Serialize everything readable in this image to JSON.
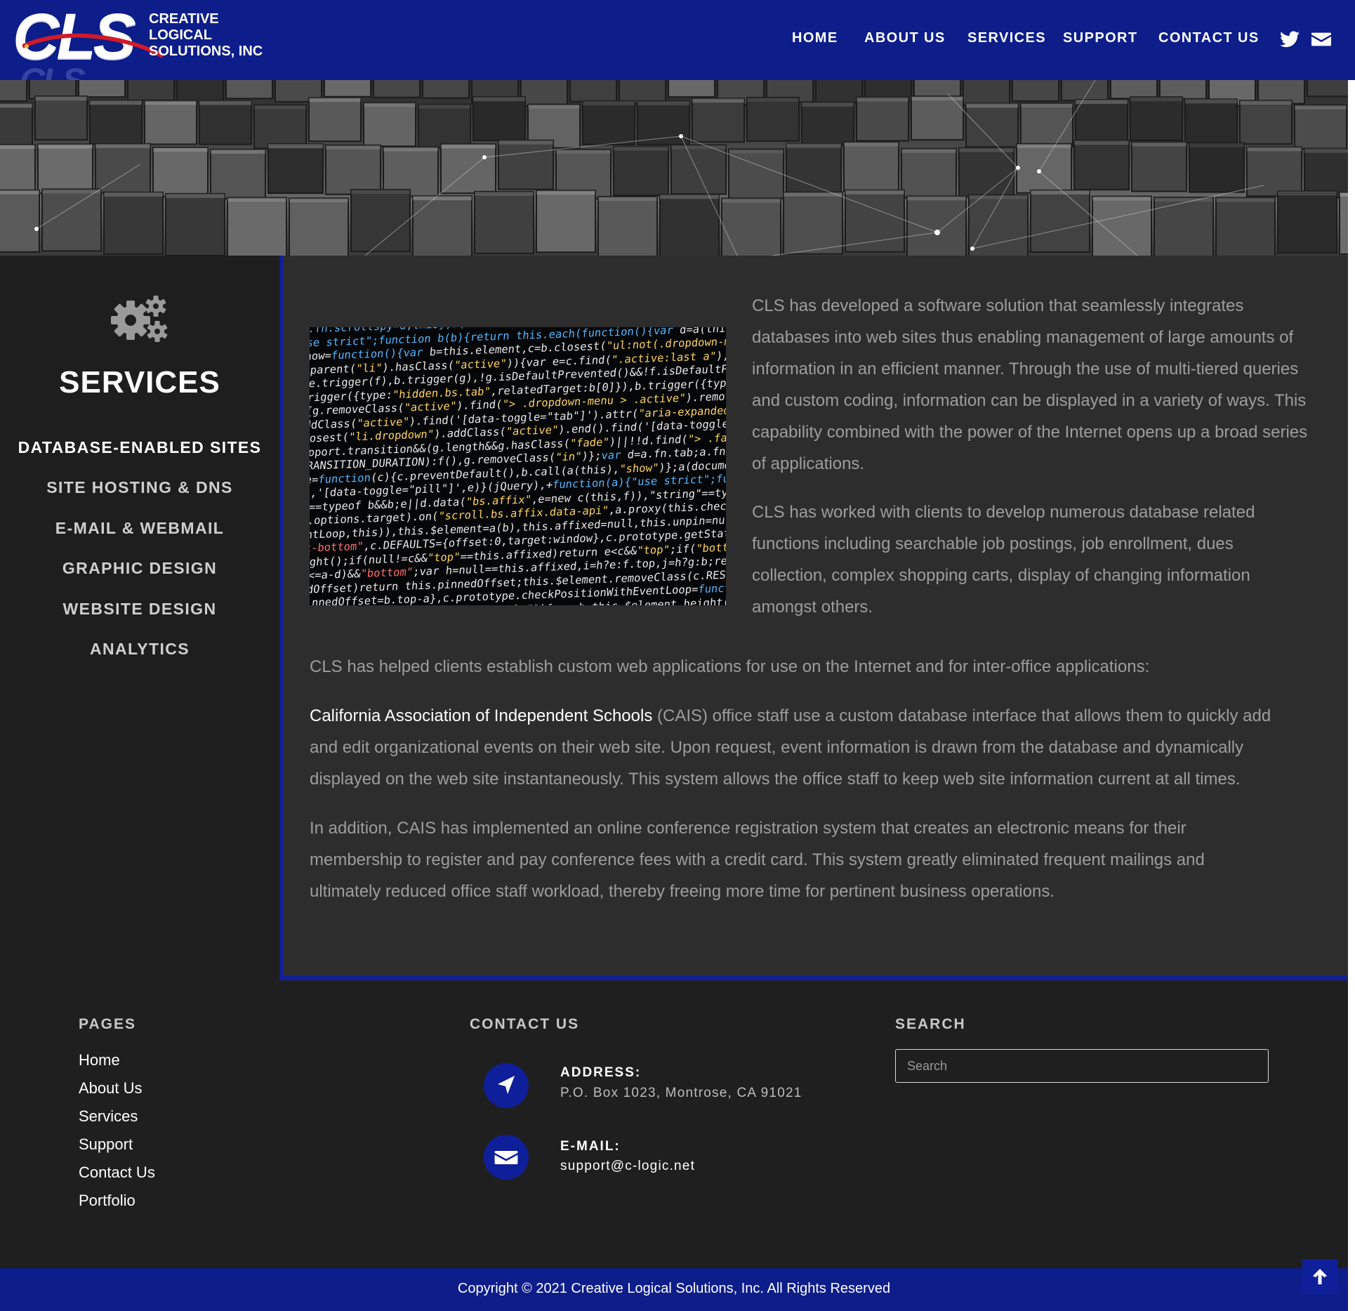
{
  "brand": {
    "logo_letters": "CLS",
    "logo_text_line1": "CREATIVE",
    "logo_text_line2": "LOGICAL",
    "logo_text_line3": "SOLUTIONS, INC"
  },
  "nav": {
    "items": [
      "HOME",
      "ABOUT US",
      "SERVICES",
      "SUPPORT",
      "CONTACT US"
    ],
    "icons": [
      "twitter-icon",
      "envelope-icon"
    ]
  },
  "sidebar": {
    "title": "SERVICES",
    "icon": "gears-icon",
    "items": [
      {
        "label": "DATABASE-ENABLED SITES",
        "active": true
      },
      {
        "label": "SITE HOSTING & DNS",
        "active": false
      },
      {
        "label": "E-MAIL & WEBMAIL",
        "active": false
      },
      {
        "label": "GRAPHIC DESIGN",
        "active": false
      },
      {
        "label": "WEBSITE DESIGN",
        "active": false
      },
      {
        "label": "ANALYTICS",
        "active": false
      }
    ]
  },
  "main": {
    "p1_lines": [
      "CLS has developed a software solution that seamlessly integrates",
      "databases into web sites thus enabling management of large amounts of",
      "information in an efficient manner. Through the use of multi-tiered queries",
      "and custom coding, information can be displayed in a variety of ways. This",
      "capability combined with the power of the Internet opens up a broad series",
      "of applications."
    ],
    "p2_lines": [
      "CLS has worked with clients to develop numerous database related",
      "functions including searchable job postings, job enrollment, dues",
      "collection, complex shopping carts, display of changing information",
      "amongst others."
    ],
    "p3": "CLS has helped clients establish custom web applications for use on the Internet and for inter-office applications:",
    "p4_link": "California Association of Independent Schools",
    "p4_line1_rest": " (CAIS) office staff use a custom database interface that allows them to quickly add",
    "p4_line2": "and edit organizational events on their web site. Upon request, event information is drawn from the database and dynamically",
    "p4_line3": "displayed on the web site instantaneously. This system allows the office staff to keep web site information current at all times.",
    "p5_lines": [
      "In addition, CAIS has implemented an online conference registration system that creates an electronic means for their",
      "membership to register and pay conference fees with a credit card. This system greatly eliminated frequent mailings and",
      "ultimately reduced office staff workload, thereby freeing more time for pertinent business operations."
    ]
  },
  "footer": {
    "pages_heading": "PAGES",
    "pages": [
      "Home",
      "About Us",
      "Services",
      "Support",
      "Contact Us",
      "Portfolio"
    ],
    "contact_heading": "CONTACT US",
    "address_label": "ADDRESS:",
    "address_value": "P.O. Box 1023, Montrose, CA 91021",
    "email_label": "E-MAIL:",
    "email_value": "support@c-logic.net",
    "search_heading": "SEARCH",
    "search_placeholder": "Search",
    "copyright": "Copyright © 2021 Creative Logical Solutions, Inc. All Rights Reserved"
  },
  "colors": {
    "brand_blue": "#0d1d8a",
    "accent_blue": "#0f1f9a",
    "sidebar_bg": "#1e1e1e",
    "main_bg": "#2d2d2d",
    "body_text": "#9d9d9d"
  }
}
